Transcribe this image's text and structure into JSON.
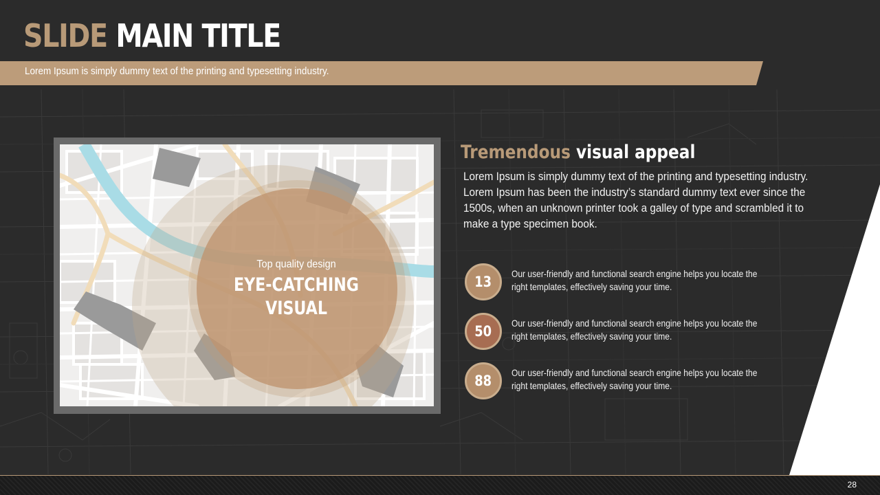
{
  "slide": {
    "title_accent": "SLIDE",
    "title_main": "MAIN TITLE",
    "subtitle": "Lorem Ipsum is simply dummy text of the printing and typesetting industry.",
    "page_number": "28"
  },
  "visual": {
    "small_label": "Top quality design",
    "big_label_line1": "EYE-CATCHING",
    "big_label_line2": "VISUAL"
  },
  "section": {
    "heading_accent": "Tremendous",
    "heading_main": "visual appeal",
    "body": "Lorem Ipsum is simply dummy text of the printing and typesetting industry. Lorem Ipsum has been the industry’s standard dummy text ever since the 1500s, when an unknown printer took a galley of type and scrambled it to make a type specimen book."
  },
  "stats": [
    {
      "value": "13",
      "text": "Our user-friendly and functional search engine helps you locate the right templates, effectively saving your time."
    },
    {
      "value": "50",
      "text": "Our user-friendly and functional search engine helps you locate the right templates, effectively saving your time."
    },
    {
      "value": "88",
      "text": "Our user-friendly and functional search engine helps you locate the right templates, effectively saving your time."
    }
  ],
  "colors": {
    "background": "#2b2b2b",
    "accent_tan": "#bc9c7a",
    "accent_text": "#b89a78",
    "badge_light": "#b48e6b",
    "badge_dark": "#a76d52",
    "river": "#a9dce6",
    "map_base": "#f0efee"
  }
}
